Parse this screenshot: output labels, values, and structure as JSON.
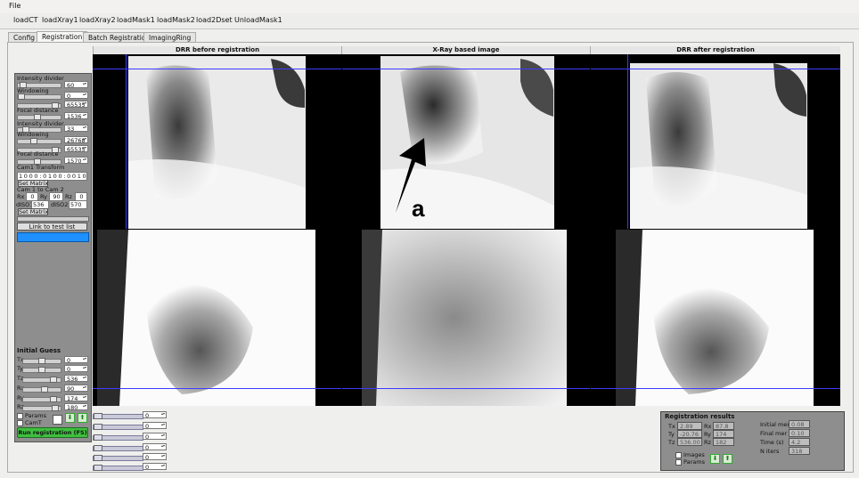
{
  "menu": {
    "file": "File"
  },
  "toolbar": [
    "loadCT",
    "loadXray1",
    "loadXray2",
    "loadMask1",
    "loadMask2",
    "load2Dset",
    "UnloadMask1"
  ],
  "tabs": [
    "Config",
    "Registration",
    "Batch Registration",
    "ImagingRing"
  ],
  "left_panel": {
    "intensity_divider_1": "Intensity divider",
    "intensity_value_1": "60",
    "windowing_1": "Windowing",
    "window_low_1": "0",
    "window_high_1": "65535",
    "focal_distance_1": "Focal distance",
    "focal_value_1": "1536",
    "intensity_divider_2": "Intensity divider",
    "intensity_value_2": "33",
    "windowing_2": "Windowing",
    "window_low_2": "26768",
    "window_high_2": "65535",
    "focal_distance_2": "Focal distance",
    "focal_value_2": "1570",
    "cam1_transform": "Cam1 Transform",
    "cam1_matrix": "1 0 0 0 : 0 1 0 0 : 0 0 1 0",
    "set_matrix_1": "Set Matrix",
    "cam1_to_cam2": "Cam 1 to Cam 2",
    "rx_label": "Rx",
    "rx_value": "0",
    "ry_label": "Ry",
    "ry_value": "90",
    "rz_label": "Rz",
    "rz_value": "0",
    "dis01_label": "dISO1",
    "dis01_value": "536",
    "dis02_label": "dISO2",
    "dis02_value": "570",
    "set_matrix_2": "Set Matrix",
    "link_to_test_list": "Link to test list",
    "initial_guess": "Initial Guess",
    "guess": [
      {
        "label": "Tx",
        "value": "0"
      },
      {
        "label": "Ty",
        "value": "0"
      },
      {
        "label": "Tz",
        "value": "536"
      },
      {
        "label": "Rx",
        "value": "90"
      },
      {
        "label": "Ry",
        "value": "174"
      },
      {
        "label": "Rz",
        "value": "180"
      }
    ],
    "params": "Params",
    "cam_t": "CamT",
    "run_registration": "Run registration (FS)"
  },
  "viewer": {
    "headers": [
      "DRR before registration",
      "X-Ray based image",
      "DRR after registration"
    ],
    "annotation": "a"
  },
  "bottom_spins": [
    "0",
    "0",
    "0",
    "0",
    "0",
    "0"
  ],
  "results": {
    "title": "Registration results",
    "labels": {
      "tx": "Tx",
      "ty": "Ty",
      "tz": "Tz",
      "rx": "Rx",
      "ry": "Ry",
      "rz": "Rz"
    },
    "tx": "2.89",
    "ty": "-20.76",
    "tz": "536.00",
    "rx": "87.8",
    "ry": "174",
    "rz": "182",
    "initial_mer": "Initial mer",
    "final_mer": "Final mer",
    "time": "Time (s)",
    "n_iters": "N iters",
    "initial_mer_value": "0.08",
    "final_mer_value": "0.10",
    "time_value": "4.2",
    "n_iters_value": "318",
    "images": "Images",
    "params": "Params"
  },
  "colors": {
    "panel_bg": "#8e8e8e",
    "run_button": "#3fbf3f",
    "progress_bar": "#1e90ff",
    "overlay_lines": "#3b3bff"
  }
}
